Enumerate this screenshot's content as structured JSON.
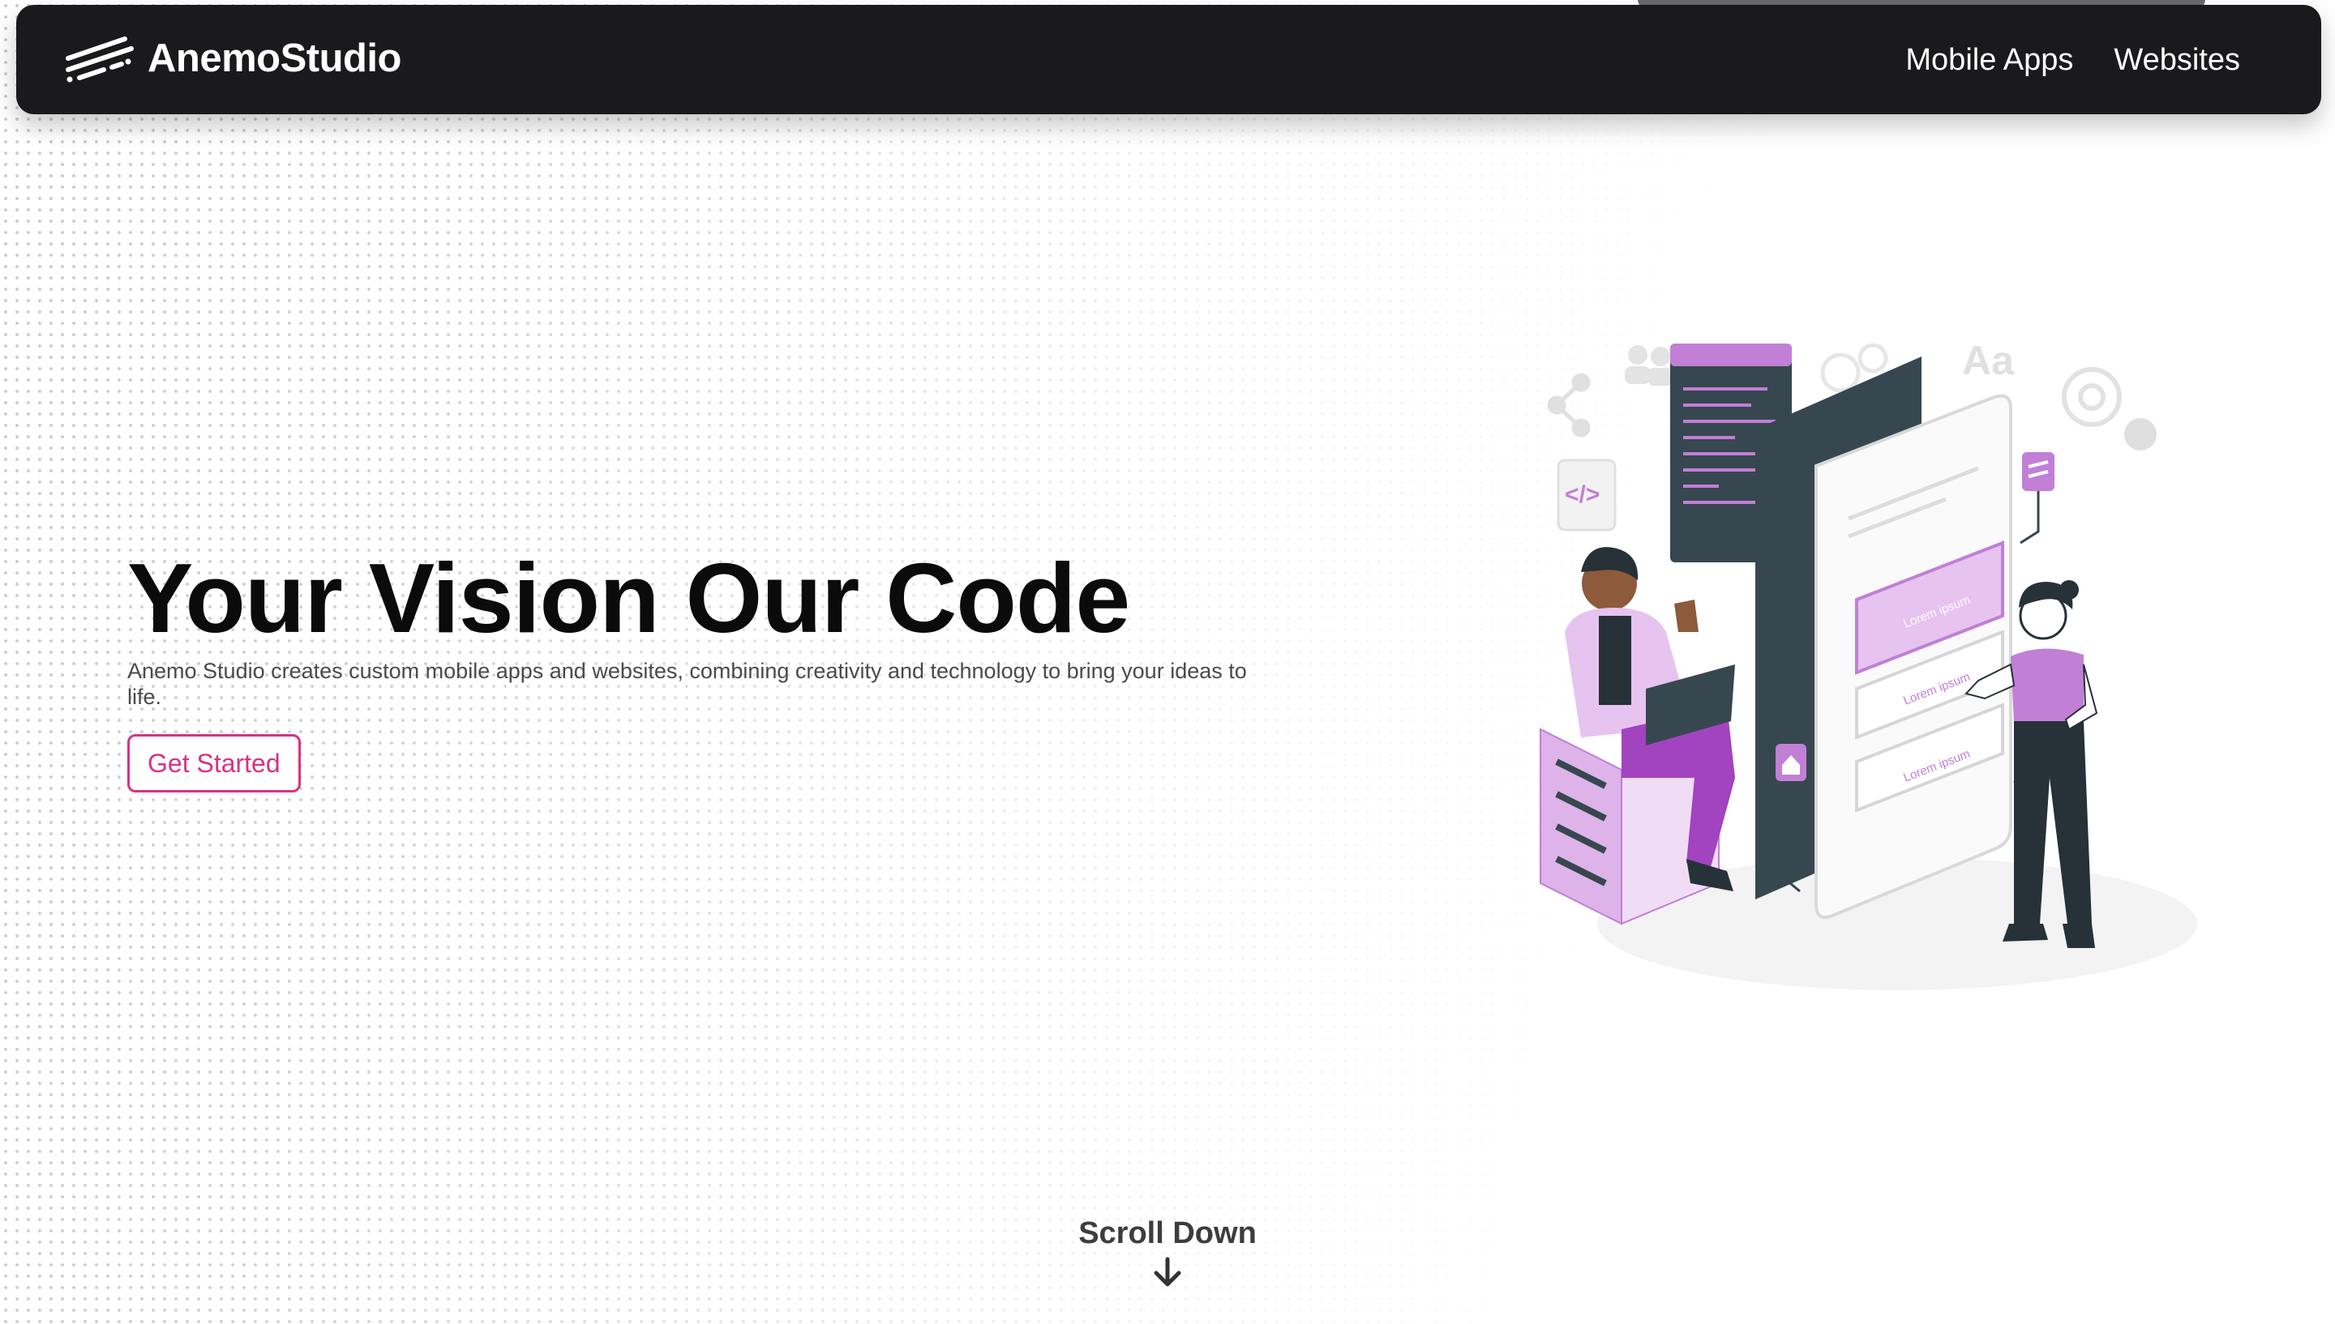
{
  "brand": {
    "name": "AnemoStudio",
    "logo_icon": "wind-lines-icon"
  },
  "nav": {
    "items": [
      {
        "label": "Mobile Apps"
      },
      {
        "label": "Websites"
      }
    ]
  },
  "hero": {
    "title": "Your Vision Our Code",
    "description": "Anemo Studio creates custom mobile apps and websites, combining creativity and technology to bring your ideas to life.",
    "cta_label": "Get Started"
  },
  "illustration": {
    "card_labels": [
      "Lorem ipsum",
      "Lorem ipsum",
      "Lorem ipsum"
    ],
    "glyph_code": "</>",
    "glyph_font": "Aa"
  },
  "scroll": {
    "label": "Scroll Down",
    "icon": "arrow-down-icon"
  },
  "colors": {
    "navbar_bg": "#1a1a1c",
    "accent": "#d63384",
    "illustration_purple": "#c17fd6",
    "illustration_dark": "#37474f"
  }
}
